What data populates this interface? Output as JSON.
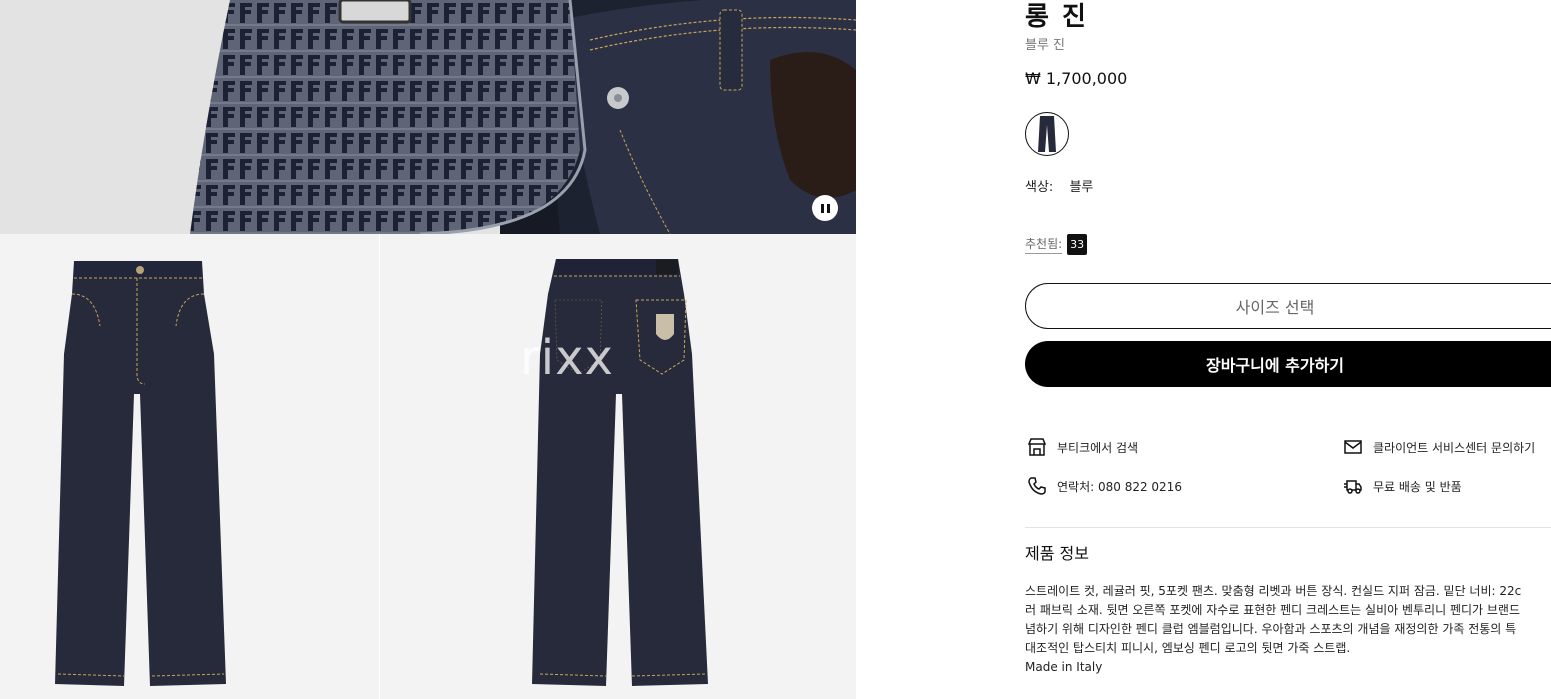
{
  "product": {
    "title": "롱 진",
    "subtitle": "블루 진",
    "price": "₩ 1,700,000",
    "color_label": "색상:",
    "color_value": "블루",
    "recommended_label": "추천됨:",
    "recommended_count": "33"
  },
  "actions": {
    "select_size": "사이즈 선택",
    "add_to_cart": "장바구니에 추가하기"
  },
  "services": {
    "find_in_boutique": "부티크에서 검색",
    "client_service": "클라이언트 서비스센터 문의하기",
    "contact": "연락처: 080 822 0216",
    "free_shipping": "무료 배송 및 반품"
  },
  "details": {
    "heading": "제품 정보",
    "lines": [
      "스트레이트 컷, 레귤러 핏, 5포켓 팬츠. 맞춤형 리벳과 버튼 장식. 컨실드 지퍼 잠금. 밑단 너비: 22c",
      "러 패브릭 소재. 뒷면 오른쪽 포켓에 자수로 표현한 펜디 크레스트는 실비아 벤투리니 펜디가 브랜드",
      "념하기 위해 디자인한 펜디 클럽 엠블럼입니다. 우아함과 스포츠의 개념을 재정의한 가족 전통의 특",
      "대조적인 탑스티치 피니시, 엠보싱 펜디 로고의 뒷면 가죽 스트랩.",
      "Made in Italy"
    ]
  },
  "gallery": {
    "watermark": "rixx"
  },
  "colors": {
    "denim": "#262a3a",
    "stitch": "#c9a45a",
    "button_black": "#000000"
  }
}
